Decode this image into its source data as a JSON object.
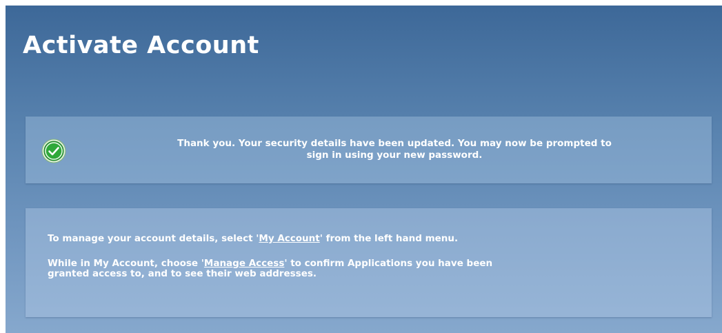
{
  "page": {
    "title": "Activate Account"
  },
  "status": {
    "icon": "check-circle-icon",
    "message_line1": "Thank you. Your security details have been updated. You may now be prompted to",
    "message_line2": "sign in using your new password."
  },
  "info": {
    "para1_before": "To manage your account details, select '",
    "para1_link": "My Account",
    "para1_after": "' from the left hand menu.",
    "para2_before": "While in My Account, choose '",
    "para2_link": "Manage Access",
    "para2_after_line1": "' to confirm Applications you have been",
    "para2_line2": "granted access to, and to see their web addresses."
  },
  "colors": {
    "panel_top": "#3d6898",
    "panel_bottom": "#86a8cd",
    "success_green": "#2fa83a",
    "text": "#ffffff"
  }
}
